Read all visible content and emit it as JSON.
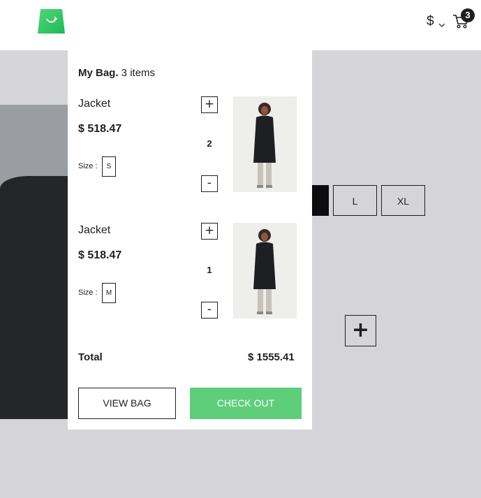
{
  "header": {
    "logo_icon": "shopping-bag-logo-icon",
    "currency_symbol": "$",
    "cart_icon": "cart-icon",
    "cart_count": "3",
    "accent_color": "#5ece7b"
  },
  "background": {
    "sizes": [
      "L",
      "XL"
    ],
    "plus_icon": "+"
  },
  "minicart": {
    "title_bold": "My Bag.",
    "title_count": " 3 items",
    "items": [
      {
        "name": "Jacket",
        "price": "$ 518.47",
        "size_label": "Size :",
        "size": "S",
        "plus": "+",
        "quantity": "2",
        "minus": "-"
      },
      {
        "name": "Jacket",
        "price": "$ 518.47",
        "size_label": "Size :",
        "size": "M",
        "plus": "+",
        "quantity": "1",
        "minus": "-"
      }
    ],
    "total_label": "Total",
    "total_value": "$ 1555.41",
    "view_bag_label": "VIEW BAG",
    "checkout_label": "CHECK OUT"
  }
}
